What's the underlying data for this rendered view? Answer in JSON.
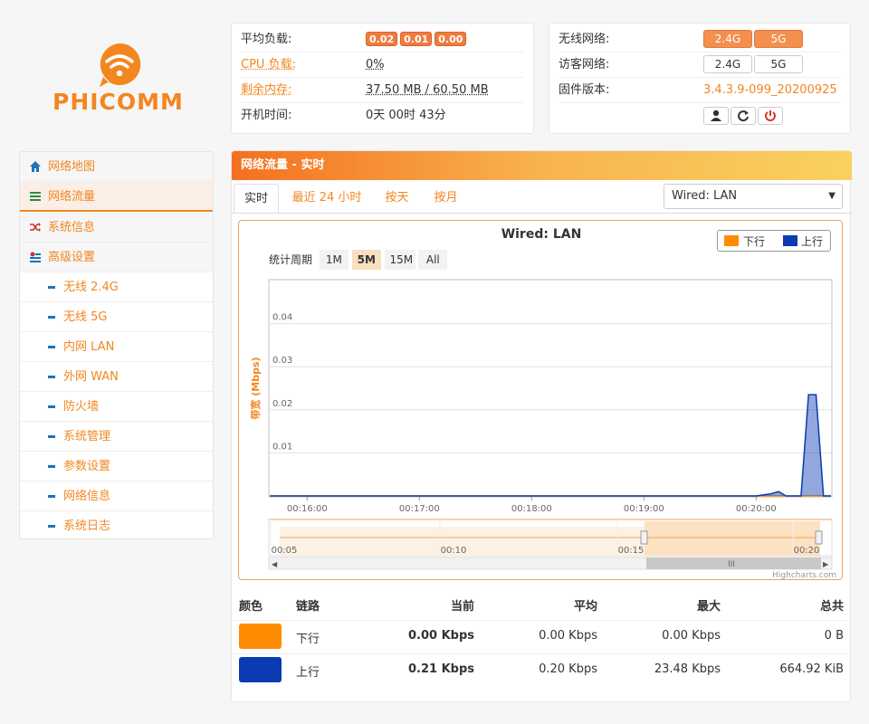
{
  "logo": {
    "brand": "PHICOMM",
    "color": "#f3861f"
  },
  "status": {
    "load_label": "平均负载:",
    "load_values": [
      "0.02",
      "0.01",
      "0.00"
    ],
    "cpu_label": "CPU 负载:",
    "cpu_value": "0%",
    "mem_label": "剩余内存:",
    "mem_value": "37.50 MB / 60.50 MB",
    "uptime_label": "开机时间:",
    "uptime_value": "0天 00时 43分"
  },
  "wireless": {
    "wifi_label": "无线网络:",
    "guest_label": "访客网络:",
    "band_24": "2.4G",
    "band_5": "5G",
    "fw_label": "固件版本:",
    "fw_value": "3.4.3.9-099_20200925",
    "buttons": [
      "user-icon",
      "refresh-icon",
      "power-icon"
    ]
  },
  "sidebar": {
    "items": [
      {
        "label": "网络地图",
        "icon": "home-icon"
      },
      {
        "label": "网络流量",
        "icon": "traffic-icon"
      },
      {
        "label": "系统信息",
        "icon": "shuffle-icon"
      },
      {
        "label": "高级设置",
        "icon": "settings-icon"
      }
    ],
    "sub": [
      "无线 2.4G",
      "无线 5G",
      "内网 LAN",
      "外网 WAN",
      "防火墙",
      "系统管理",
      "参数设置",
      "网络信息",
      "系统日志"
    ]
  },
  "main": {
    "title": "网络流量 - 实时",
    "tabs": [
      "实时",
      "最近 24 小时",
      "按天",
      "按月"
    ],
    "select_value": "Wired: LAN"
  },
  "chart": {
    "period_label": "统计周期",
    "periods": [
      "1M",
      "5M",
      "15M",
      "All"
    ],
    "period_selected": "5M",
    "credit": "Highcharts.com",
    "colors": {
      "down": "#ff8c00",
      "up": "#0b3bb3"
    }
  },
  "chart_data": {
    "type": "area",
    "title": "Wired: LAN",
    "ylabel": "带宽 (Mbps)",
    "ylim": [
      0,
      0.05
    ],
    "yticks": [
      "0.01",
      "0.02",
      "0.03",
      "0.04"
    ],
    "xticks": [
      "00:16:00",
      "00:17:00",
      "00:18:00",
      "00:19:00",
      "00:20:00"
    ],
    "navigator_ticks": [
      "00:05",
      "00:10",
      "00:15",
      "00:20"
    ],
    "legend": [
      "下行",
      "上行"
    ],
    "series": [
      {
        "name": "下行",
        "x": [
          "00:15:40",
          "00:20:20",
          "00:20:24",
          "00:20:30",
          "00:20:34",
          "00:20:40"
        ],
        "values": [
          0,
          0,
          0,
          0,
          0,
          0
        ]
      },
      {
        "name": "上行",
        "x": [
          "00:15:40",
          "00:20:00",
          "00:20:08",
          "00:20:12",
          "00:20:16",
          "00:20:20",
          "00:20:24",
          "00:20:28",
          "00:20:32",
          "00:20:36",
          "00:20:40"
        ],
        "values": [
          0,
          0,
          0.0005,
          0.001,
          0,
          0,
          0,
          0.0235,
          0.0235,
          0,
          0
        ]
      }
    ]
  },
  "table": {
    "headers": [
      "颜色",
      "链路",
      "当前",
      "平均",
      "最大",
      "总共"
    ],
    "rows": [
      {
        "color": "#ff8c00",
        "link": "下行",
        "current": "0.00 Kbps",
        "avg": "0.00 Kbps",
        "max": "0.00 Kbps",
        "total": "0 B"
      },
      {
        "color": "#0b3bb3",
        "link": "上行",
        "current": "0.21 Kbps",
        "avg": "0.20 Kbps",
        "max": "23.48 Kbps",
        "total": "664.92 KiB"
      }
    ]
  }
}
